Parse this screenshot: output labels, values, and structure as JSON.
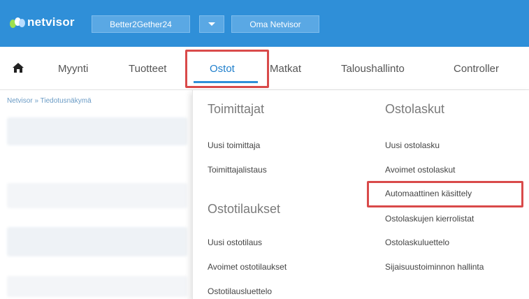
{
  "topbar": {
    "logo_text": "netvisor",
    "company_name": "Better2Gether24",
    "oma_label": "Oma Netvisor"
  },
  "nav": {
    "items": [
      {
        "label": "Myynti"
      },
      {
        "label": "Tuotteet"
      },
      {
        "label": "Ostot"
      },
      {
        "label": "Matkat"
      },
      {
        "label": "Taloushallinto"
      },
      {
        "label": "Controller"
      }
    ]
  },
  "breadcrumb": {
    "root": "Netvisor",
    "separator": "»",
    "current": "Tiedotusnäkymä"
  },
  "menu": {
    "col1": {
      "groups": [
        {
          "heading": "Toimittajat",
          "items": [
            "Uusi toimittaja",
            "Toimittajalistaus"
          ]
        },
        {
          "heading": "Ostotilaukset",
          "items": [
            "Uusi ostotilaus",
            "Avoimet ostotilaukset",
            "Ostotilausluettelo"
          ]
        }
      ]
    },
    "col2": {
      "heading": "Ostolaskut",
      "items": [
        "Uusi ostolasku",
        "Avoimet ostolaskut",
        "Automaattinen käsittely",
        "Ostolaskujen kierrolistat",
        "Ostolaskuluettelo",
        "Sijaisuustoiminnon hallinta"
      ]
    }
  },
  "colors": {
    "topbar": "#2f8fd8",
    "highlight": "#d94a4a",
    "active_nav": "#1f7fcc"
  }
}
